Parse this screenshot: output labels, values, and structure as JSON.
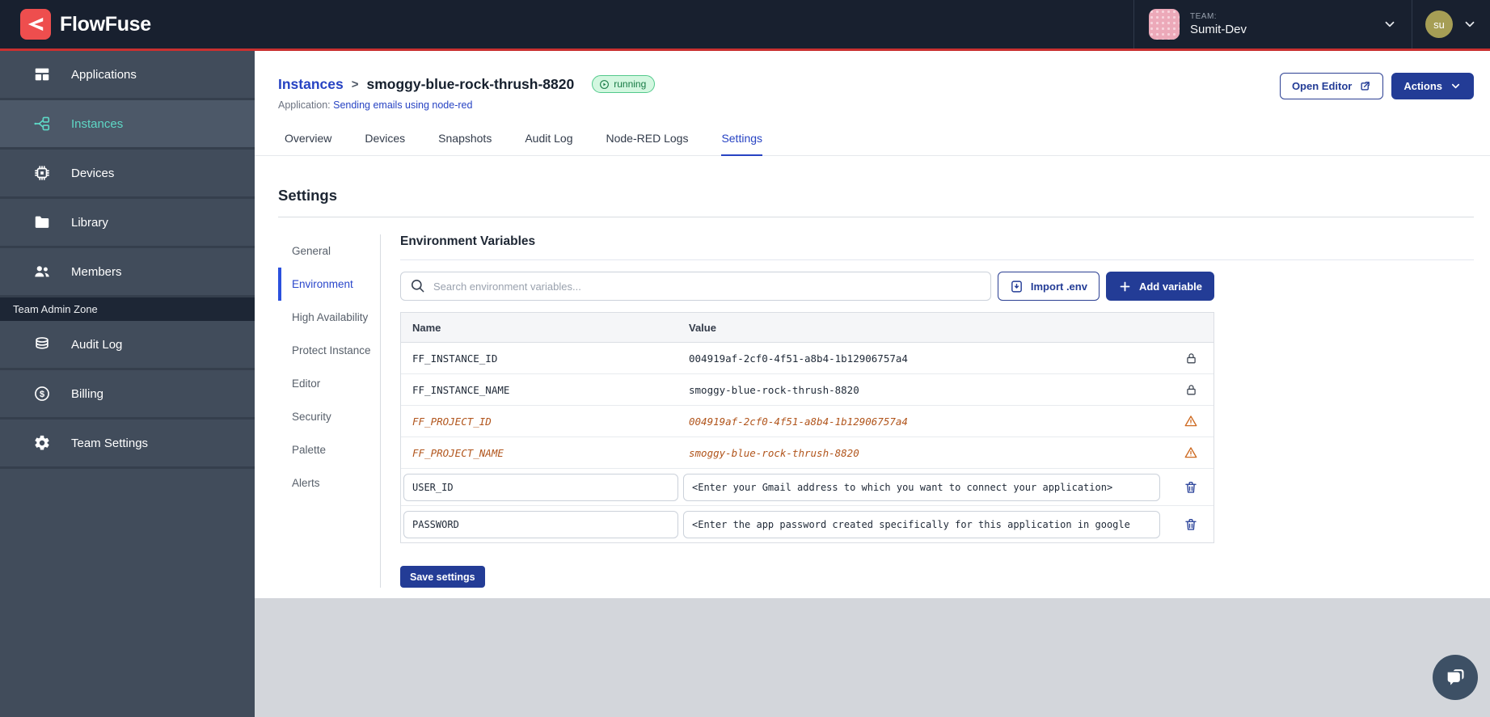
{
  "topbar": {
    "brand": "FlowFuse",
    "team_label": "TEAM:",
    "team_name": "Sumit-Dev",
    "user_initials": "su"
  },
  "sidebar": {
    "items": [
      {
        "label": "Applications",
        "icon": "applications-icon",
        "active": false
      },
      {
        "label": "Instances",
        "icon": "instances-icon",
        "active": true
      },
      {
        "label": "Devices",
        "icon": "devices-icon",
        "active": false
      },
      {
        "label": "Library",
        "icon": "library-icon",
        "active": false
      },
      {
        "label": "Members",
        "icon": "members-icon",
        "active": false
      }
    ],
    "admin_zone_label": "Team Admin Zone",
    "admin_items": [
      {
        "label": "Audit Log",
        "icon": "audit-log-icon"
      },
      {
        "label": "Billing",
        "icon": "billing-icon"
      },
      {
        "label": "Team Settings",
        "icon": "gear-icon"
      }
    ]
  },
  "header": {
    "breadcrumb_parent": "Instances",
    "breadcrumb_separator": ">",
    "instance_name": "smoggy-blue-rock-thrush-8820",
    "status_badge": "running",
    "application_label": "Application:",
    "application_link": "Sending emails using node-red",
    "open_editor_label": "Open Editor",
    "actions_label": "Actions"
  },
  "tabs": [
    {
      "label": "Overview",
      "active": false
    },
    {
      "label": "Devices",
      "active": false
    },
    {
      "label": "Snapshots",
      "active": false
    },
    {
      "label": "Audit Log",
      "active": false
    },
    {
      "label": "Node-RED Logs",
      "active": false
    },
    {
      "label": "Settings",
      "active": true
    }
  ],
  "settings": {
    "title": "Settings",
    "nav": [
      {
        "label": "General",
        "active": false
      },
      {
        "label": "Environment",
        "active": true
      },
      {
        "label": "High Availability",
        "active": false
      },
      {
        "label": "Protect Instance",
        "active": false
      },
      {
        "label": "Editor",
        "active": false
      },
      {
        "label": "Security",
        "active": false
      },
      {
        "label": "Palette",
        "active": false
      },
      {
        "label": "Alerts",
        "active": false
      }
    ],
    "panel_title": "Environment Variables",
    "search_placeholder": "Search environment variables...",
    "import_button_label": "Import .env",
    "add_button_label": "Add variable",
    "table": {
      "columns": [
        "Name",
        "Value"
      ],
      "rows": [
        {
          "name": "FF_INSTANCE_ID",
          "value": "004919af-2cf0-4f51-a8b4-1b12906757a4",
          "state": "locked"
        },
        {
          "name": "FF_INSTANCE_NAME",
          "value": "smoggy-blue-rock-thrush-8820",
          "state": "locked"
        },
        {
          "name": "FF_PROJECT_ID",
          "value": "004919af-2cf0-4f51-a8b4-1b12906757a4",
          "state": "deprecated"
        },
        {
          "name": "FF_PROJECT_NAME",
          "value": "smoggy-blue-rock-thrush-8820",
          "state": "deprecated"
        },
        {
          "name": "USER_ID",
          "value": "<Enter your Gmail address to which you want to connect your application>",
          "state": "editable"
        },
        {
          "name": "PASSWORD",
          "value": "<Enter the app password created specifically for this application in google",
          "state": "editable"
        }
      ]
    },
    "save_button_label": "Save settings"
  },
  "icons": {
    "logo": "flowfuse-mark",
    "search": "magnifier",
    "import": "document-arrow-down",
    "add": "plus",
    "open_editor": "external-link",
    "actions": "chevron-down",
    "status": "play-circle",
    "locked": "padlock",
    "deprecated": "warning-triangle",
    "delete": "trash-can",
    "chat": "chat-bubbles",
    "team_dropdown": "chevron-down",
    "user_dropdown": "chevron-down"
  },
  "colors": {
    "topbar_bg": "#18202F",
    "accent_red": "#C93030",
    "logo_red": "#EE4E4E",
    "sidebar_bg": "#414C5B",
    "sidebar_active_bg": "#4C5868",
    "sidebar_active_teal": "#5ED8C6",
    "admin_band_bg": "#1D2635",
    "link_blue": "#2743C3",
    "button_navy": "#233C96",
    "status_green_bg": "#D3F7E0",
    "status_green_border": "#52C98B",
    "status_green_text": "#177A44",
    "deprecated_orange": "#B1551C",
    "table_header_bg": "#F5F6F8",
    "bottom_gray": "#D3D6DB",
    "chat_fab": "#3D5065"
  }
}
